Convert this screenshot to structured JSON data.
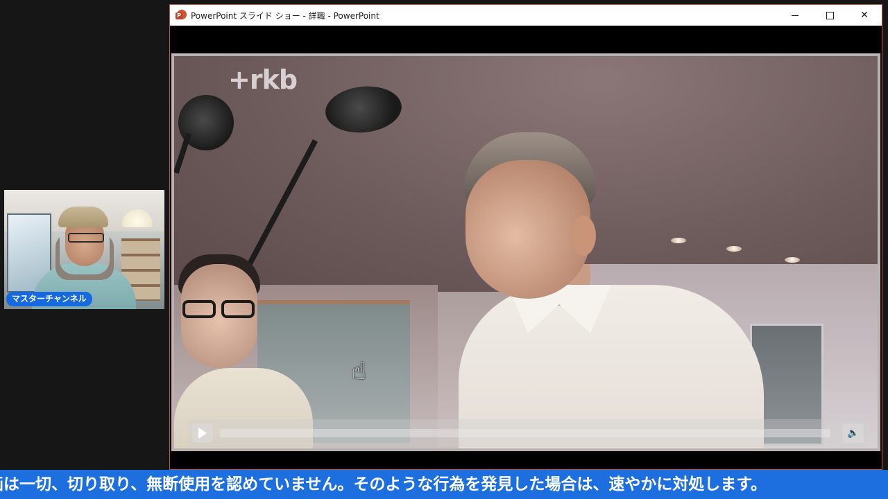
{
  "webcam": {
    "channel_label": "マスターチャンネル"
  },
  "window": {
    "title": "PowerPoint スライド ショー  -  詳職 - PowerPoint",
    "app_icon_letter": "P",
    "controls": {
      "minimize": "minimize-icon",
      "maximize": "maximize-icon",
      "close_glyph": "✕"
    }
  },
  "slide": {
    "logo_text": "+rkb",
    "cursor_glyph": "☝",
    "media_controls": {
      "play_icon": "play-icon",
      "volume_glyph": "🔈"
    }
  },
  "ticker": {
    "text": "画は一切、切り取り、無断使用を認めていません。そのような行為を発見した場合は、速やかに対処します。"
  },
  "colors": {
    "ticker_bg": "#1d6fe0",
    "badge_bg": "#1769e0",
    "powerpoint_red": "#d35230"
  }
}
